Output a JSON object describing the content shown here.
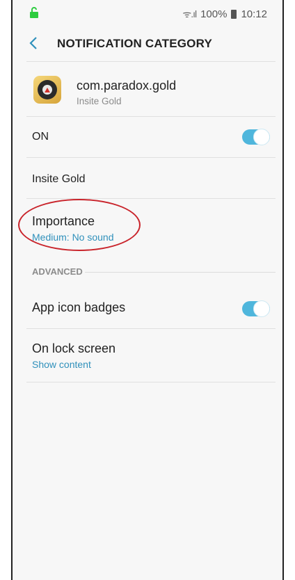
{
  "status_bar": {
    "signal_text": "ᯤ.ıl",
    "battery": "100%",
    "time": "10:12",
    "lock_icon": "unlocked-lock-icon",
    "accent": "#2ecc40"
  },
  "header": {
    "title": "NOTIFICATION CATEGORY",
    "back_icon": "chevron-left-icon"
  },
  "app": {
    "package": "com.paradox.gold",
    "name": "Insite Gold"
  },
  "master": {
    "label": "ON",
    "enabled": true
  },
  "category": {
    "label": "Insite Gold"
  },
  "importance": {
    "title": "Importance",
    "value": "Medium: No sound"
  },
  "advanced": {
    "section_label": "ADVANCED",
    "badges_label": "App icon badges",
    "badges_enabled": true,
    "lock_title": "On lock screen",
    "lock_value": "Show content"
  },
  "colors": {
    "toggle": "#4fb6dc",
    "link": "#2f90bb",
    "annotation": "#c9242b"
  }
}
